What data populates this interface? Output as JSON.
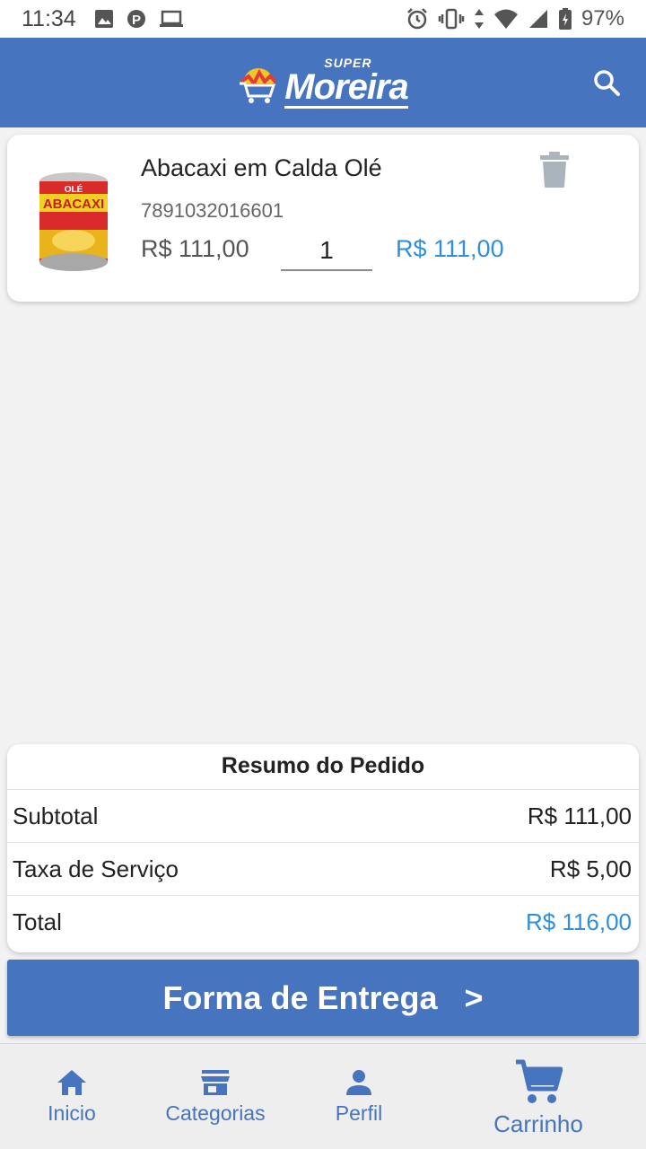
{
  "status_bar": {
    "time": "11:34",
    "battery": "97%"
  },
  "app_bar": {
    "logo_small": "SUPER",
    "logo_main": "Moreira",
    "search_icon": "search-icon"
  },
  "cart": {
    "items": [
      {
        "name": "Abacaxi em Calda Olé",
        "code": "7891032016601",
        "unit_price": "R$ 111,00",
        "quantity": "1",
        "total": "R$ 111,00",
        "image_label_brand": "OLÉ",
        "image_label_product": "ABACAXI"
      }
    ]
  },
  "summary": {
    "title": "Resumo do Pedido",
    "subtotal_label": "Subtotal",
    "subtotal_value": "R$ 111,00",
    "fee_label": "Taxa de Serviço",
    "fee_value": "R$ 5,00",
    "total_label": "Total",
    "total_value": "R$ 116,00"
  },
  "action": {
    "label": "Forma de Entrega",
    "arrow": ">"
  },
  "bottom_nav": {
    "items": [
      {
        "label": "Inicio",
        "icon": "home-icon"
      },
      {
        "label": "Categorias",
        "icon": "store-icon"
      },
      {
        "label": "Perfil",
        "icon": "person-icon"
      },
      {
        "label": "Carrinho",
        "icon": "cart-icon"
      }
    ]
  },
  "colors": {
    "primary": "#4674bf",
    "price_accent": "#2f8fdc"
  }
}
